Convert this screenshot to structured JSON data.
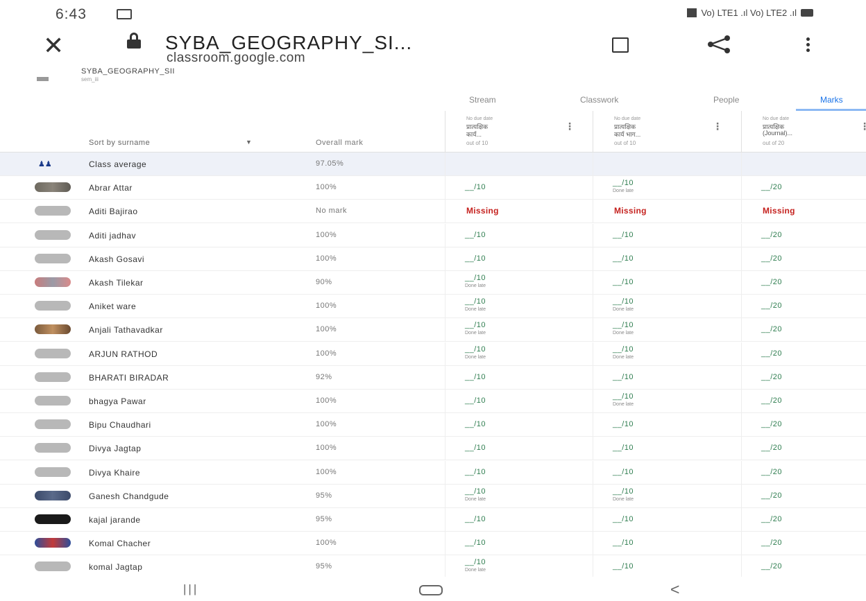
{
  "status_bar": {
    "time": "6:43",
    "network": "Vo) LTE1 .ıl Vo) LTE2 .ıl"
  },
  "browser": {
    "title": "SYBA_GEOGRAPHY_SI...",
    "domain": "classroom.google.com"
  },
  "classroom": {
    "class_name": "SYBA_GEOGRAPHY_SII",
    "section": "sem_iii",
    "tabs": [
      "Stream",
      "Classwork",
      "People",
      "Marks"
    ],
    "active_tab": "Marks"
  },
  "table": {
    "sort_label": "Sort by surname",
    "overall_label": "Overall mark",
    "assignments": [
      {
        "due": "No due date",
        "line1": "प्रात्यक्षिक",
        "line2": "कार्य...",
        "out_of": "out of 10"
      },
      {
        "due": "No due date",
        "line1": "प्रात्यक्षिक",
        "line2": "कार्य भाग...",
        "out_of": "out of 10"
      },
      {
        "due": "No due date",
        "line1": "प्रात्यक्षिक",
        "line2": "(Journal)...",
        "out_of": "out of 20"
      }
    ],
    "class_average": {
      "label": "Class average",
      "overall": "97.05%"
    },
    "students": [
      {
        "name": "Abrar Attar",
        "overall": "100%",
        "avatar": "photo",
        "marks": [
          [
            "__/10",
            ""
          ],
          [
            "__/10",
            "Done late"
          ],
          [
            "__/20",
            ""
          ]
        ]
      },
      {
        "name": "Aditi Bajirao",
        "overall": "No mark",
        "avatar": "default",
        "marks": [
          [
            "Missing",
            ""
          ],
          [
            "Missing",
            ""
          ],
          [
            "Missing",
            ""
          ]
        ]
      },
      {
        "name": "Aditi jadhav",
        "overall": "100%",
        "avatar": "default",
        "marks": [
          [
            "__/10",
            ""
          ],
          [
            "__/10",
            ""
          ],
          [
            "__/20",
            ""
          ]
        ]
      },
      {
        "name": "Akash Gosavi",
        "overall": "100%",
        "avatar": "default",
        "marks": [
          [
            "__/10",
            ""
          ],
          [
            "__/10",
            ""
          ],
          [
            "__/20",
            ""
          ]
        ]
      },
      {
        "name": "Akash Tilekar",
        "overall": "90%",
        "avatar": "red",
        "marks": [
          [
            "__/10",
            "Done late"
          ],
          [
            "__/10",
            ""
          ],
          [
            "__/20",
            ""
          ]
        ]
      },
      {
        "name": "Aniket ware",
        "overall": "100%",
        "avatar": "default",
        "marks": [
          [
            "__/10",
            "Done late"
          ],
          [
            "__/10",
            "Done late"
          ],
          [
            "__/20",
            ""
          ]
        ]
      },
      {
        "name": "Anjali Tathavadkar",
        "overall": "100%",
        "avatar": "brown",
        "marks": [
          [
            "__/10",
            "Done late"
          ],
          [
            "__/10",
            "Done late"
          ],
          [
            "__/20",
            ""
          ]
        ]
      },
      {
        "name": "ARJUN RATHOD",
        "overall": "100%",
        "avatar": "default",
        "marks": [
          [
            "__/10",
            "Done late"
          ],
          [
            "__/10",
            "Done late"
          ],
          [
            "__/20",
            ""
          ]
        ]
      },
      {
        "name": "BHARATI BIRADAR",
        "overall": "92%",
        "avatar": "default",
        "marks": [
          [
            "__/10",
            ""
          ],
          [
            "__/10",
            ""
          ],
          [
            "__/20",
            ""
          ]
        ]
      },
      {
        "name": "bhagya Pawar",
        "overall": "100%",
        "avatar": "default",
        "marks": [
          [
            "__/10",
            ""
          ],
          [
            "__/10",
            "Done late"
          ],
          [
            "__/20",
            ""
          ]
        ]
      },
      {
        "name": "Bipu Chaudhari",
        "overall": "100%",
        "avatar": "default",
        "marks": [
          [
            "__/10",
            ""
          ],
          [
            "__/10",
            ""
          ],
          [
            "__/20",
            ""
          ]
        ]
      },
      {
        "name": "Divya Jagtap",
        "overall": "100%",
        "avatar": "default",
        "marks": [
          [
            "__/10",
            ""
          ],
          [
            "__/10",
            ""
          ],
          [
            "__/20",
            ""
          ]
        ]
      },
      {
        "name": "Divya Khaire",
        "overall": "100%",
        "avatar": "default",
        "marks": [
          [
            "__/10",
            ""
          ],
          [
            "__/10",
            ""
          ],
          [
            "__/20",
            ""
          ]
        ]
      },
      {
        "name": "Ganesh Chandgude",
        "overall": "95%",
        "avatar": "navy",
        "marks": [
          [
            "__/10",
            "Done late"
          ],
          [
            "__/10",
            "Done late"
          ],
          [
            "__/20",
            ""
          ]
        ]
      },
      {
        "name": "kajal jarande",
        "overall": "95%",
        "avatar": "black",
        "marks": [
          [
            "__/10",
            ""
          ],
          [
            "__/10",
            ""
          ],
          [
            "__/20",
            ""
          ]
        ]
      },
      {
        "name": "Komal Chacher",
        "overall": "100%",
        "avatar": "mixed",
        "marks": [
          [
            "__/10",
            ""
          ],
          [
            "__/10",
            ""
          ],
          [
            "__/20",
            ""
          ]
        ]
      },
      {
        "name": "komal Jagtap",
        "overall": "95%",
        "avatar": "default",
        "marks": [
          [
            "__/10",
            "Done late"
          ],
          [
            "__/10",
            ""
          ],
          [
            "__/20",
            ""
          ]
        ]
      }
    ]
  },
  "colors": {
    "mark_green": "#2e7d4f",
    "missing_red": "#c5221f",
    "average_row_bg": "#eef1f8",
    "tab_active": "#1a73e8"
  },
  "icons": {
    "close": "close-icon",
    "lock": "lock-icon",
    "bookmark": "bookmark-icon",
    "share": "share-icon",
    "menu": "more-vert-icon"
  }
}
